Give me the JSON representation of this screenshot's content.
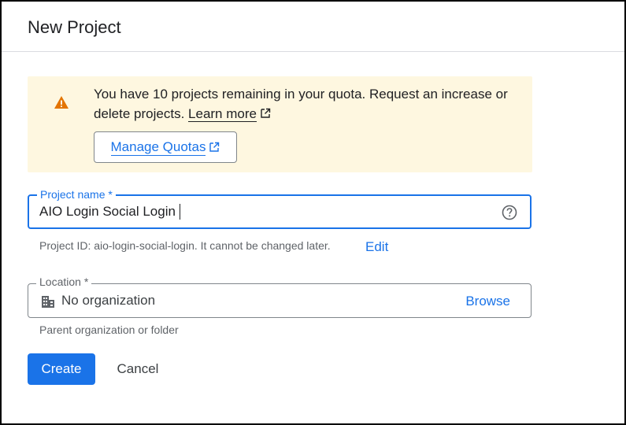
{
  "dialog": {
    "title": "New Project"
  },
  "alert": {
    "icon": "warning-icon",
    "message": "You have 10 projects remaining in your quota. Request an increase or delete projects.",
    "learn_more": "Learn more",
    "manage_quotas": "Manage Quotas",
    "accent_color": "#e37400",
    "background_color": "#fef7e0"
  },
  "project_name": {
    "label": "Project name *",
    "value": "AIO Login Social Login",
    "help_icon": "help-circle-icon",
    "project_id_hint": "Project ID: aio-login-social-login. It cannot be changed later.",
    "edit_label": "Edit"
  },
  "location": {
    "label": "Location *",
    "icon": "building-icon",
    "value": "No organization",
    "browse_label": "Browse",
    "hint": "Parent organization or folder"
  },
  "actions": {
    "create_label": "Create",
    "cancel_label": "Cancel",
    "primary_color": "#1a73e8"
  }
}
